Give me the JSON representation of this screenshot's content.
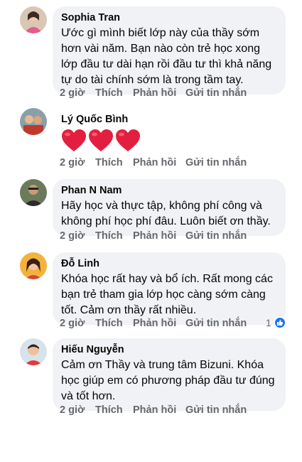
{
  "comments": [
    {
      "author": "Sophia Tran",
      "text": "Ước gì mình biết lớp này của thầy sớm hơn vài năm. Bạn nào còn trẻ học xong lớp đầu tư dài hạn rồi đầu tư thì khả năng tự do tài chính sớm là trong tầm tay.",
      "time": "2 giờ",
      "like_label": "Thích",
      "reply_label": "Phản hồi",
      "message_label": "Gửi tin nhắn"
    },
    {
      "author": "Lý Quốc Bình",
      "text": "",
      "hearts": 3,
      "time": "2 giờ",
      "like_label": "Thích",
      "reply_label": "Phản hồi",
      "message_label": "Gửi tin nhắn"
    },
    {
      "author": "Phan N Nam",
      "text": "Hãy học và thực tập, không phí công và không phí học phí đâu. Luôn biết ơn thầy.",
      "time": "2 giờ",
      "like_label": "Thích",
      "reply_label": "Phản hồi",
      "message_label": "Gửi tin nhắn"
    },
    {
      "author": "Đỗ Linh",
      "text": "Khóa học rất hay và bổ ích. Rất mong các bạn trẻ tham gia lớp học càng sớm càng tốt. Cảm ơn thầy rất nhiều.",
      "time": "2 giờ",
      "like_label": "Thích",
      "reply_label": "Phản hồi",
      "message_label": "Gửi tin nhắn",
      "reaction_count": "1"
    },
    {
      "author": "Hiếu Nguyễn",
      "text": "Cảm ơn Thầy và trung tâm Bizuni. Khóa học giúp em có phương pháp đầu tư đúng và tốt hơn.",
      "time": "2 giờ",
      "like_label": "Thích",
      "reply_label": "Phản hồi",
      "message_label": "Gửi tin nhắn"
    }
  ],
  "colors": {
    "bubble": "#f0f2f5",
    "action_text": "#65676b",
    "heart": "#e41e3f",
    "like_blue": "#1877f2"
  }
}
